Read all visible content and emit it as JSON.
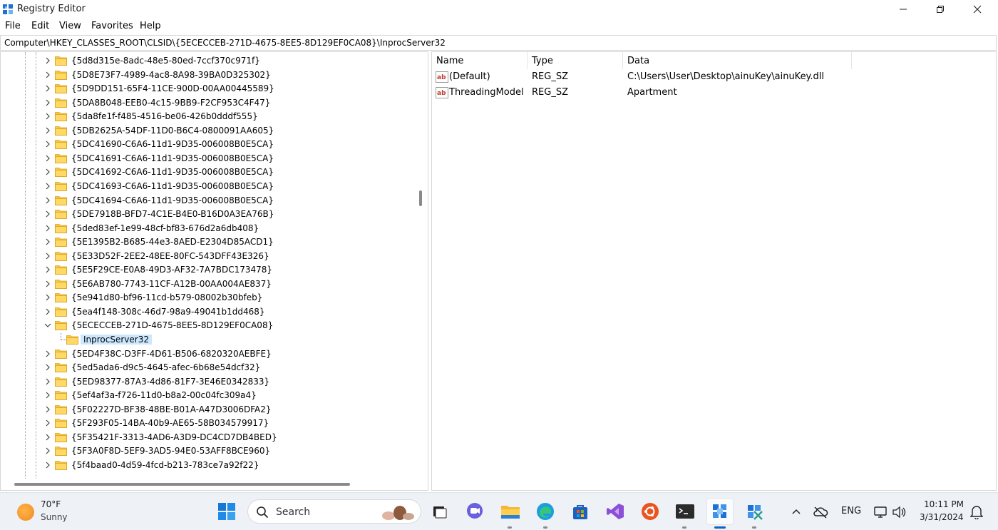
{
  "window": {
    "title": "Registry Editor"
  },
  "menu": [
    "File",
    "Edit",
    "View",
    "Favorites",
    "Help"
  ],
  "address": "Computer\\HKEY_CLASSES_ROOT\\CLSID\\{5ECECCEB-271D-4675-8EE5-8D129EF0CA08}\\InprocServer32",
  "tree": [
    {
      "label": "{5d8d315e-8adc-48e5-80ed-7ccf370c971f}",
      "expanded": false
    },
    {
      "label": "{5D8E73F7-4989-4ac8-8A98-39BA0D325302}",
      "expanded": false
    },
    {
      "label": "{5D9DD151-65F4-11CE-900D-00AA00445589}",
      "expanded": false
    },
    {
      "label": "{5DA8B048-EEB0-4c15-9BB9-F2CF953C4F47}",
      "expanded": false
    },
    {
      "label": "{5da8fe1f-f485-4516-be06-426b0dddf555}",
      "expanded": false
    },
    {
      "label": "{5DB2625A-54DF-11D0-B6C4-0800091AA605}",
      "expanded": false
    },
    {
      "label": "{5DC41690-C6A6-11d1-9D35-006008B0E5CA}",
      "expanded": false
    },
    {
      "label": "{5DC41691-C6A6-11d1-9D35-006008B0E5CA}",
      "expanded": false
    },
    {
      "label": "{5DC41692-C6A6-11d1-9D35-006008B0E5CA}",
      "expanded": false
    },
    {
      "label": "{5DC41693-C6A6-11d1-9D35-006008B0E5CA}",
      "expanded": false
    },
    {
      "label": "{5DC41694-C6A6-11d1-9D35-006008B0E5CA}",
      "expanded": false
    },
    {
      "label": "{5DE7918B-BFD7-4C1E-B4E0-B16D0A3EA76B}",
      "expanded": false
    },
    {
      "label": "{5ded83ef-1e99-48cf-bf83-676d2a6db408}",
      "expanded": false
    },
    {
      "label": "{5E1395B2-B685-44e3-8AED-E2304D85ACD1}",
      "expanded": false
    },
    {
      "label": "{5E33D52F-2EE2-48EE-80FC-543DFF43E326}",
      "expanded": false
    },
    {
      "label": "{5E5F29CE-E0A8-49D3-AF32-7A7BDC173478}",
      "expanded": false
    },
    {
      "label": "{5E6AB780-7743-11CF-A12B-00AA004AE837}",
      "expanded": false
    },
    {
      "label": "{5e941d80-bf96-11cd-b579-08002b30bfeb}",
      "expanded": false
    },
    {
      "label": "{5ea4f148-308c-46d7-98a9-49041b1dd468}",
      "expanded": false
    },
    {
      "label": "{5ECECCEB-271D-4675-8EE5-8D129EF0CA08}",
      "expanded": true
    },
    {
      "label": "InprocServer32",
      "child": true,
      "selected": true
    },
    {
      "label": "{5ED4F38C-D3FF-4D61-B506-6820320AEBFE}",
      "expanded": false
    },
    {
      "label": "{5ed5ada6-d9c5-4645-afec-6b68e54dcf32}",
      "expanded": false
    },
    {
      "label": "{5ED98377-87A3-4d86-81F7-3E46E0342833}",
      "expanded": false
    },
    {
      "label": "{5ef4af3a-f726-11d0-b8a2-00c04fc309a4}",
      "expanded": false
    },
    {
      "label": "{5F02227D-BF38-48BE-B01A-A47D3006DFA2}",
      "expanded": false
    },
    {
      "label": "{5F293F05-14BA-40b9-AE65-58B034579917}",
      "expanded": false
    },
    {
      "label": "{5F35421F-3313-4AD6-A3D9-DC4CD7DB4BED}",
      "expanded": false
    },
    {
      "label": "{5F3A0F8D-5EF9-3AD5-94E0-53AFF8BCE960}",
      "expanded": false
    },
    {
      "label": "{5f4baad0-4d59-4fcd-b213-783ce7a92f22}",
      "expanded": false
    }
  ],
  "values": {
    "columns": [
      "Name",
      "Type",
      "Data"
    ],
    "rows": [
      {
        "name": "(Default)",
        "type": "REG_SZ",
        "data": "C:\\Users\\User\\Desktop\\ainuKey\\ainuKey.dll"
      },
      {
        "name": "ThreadingModel",
        "type": "REG_SZ",
        "data": "Apartment"
      }
    ]
  },
  "taskbar": {
    "weather": {
      "temp": "70°F",
      "desc": "Sunny"
    },
    "search_placeholder": "Search",
    "language": "ENG",
    "time": "10:11 PM",
    "date": "3/31/2024"
  }
}
